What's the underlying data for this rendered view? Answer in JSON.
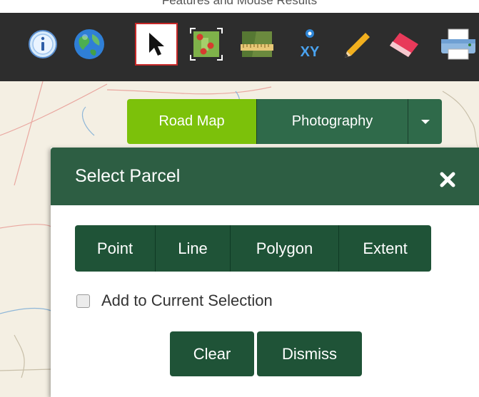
{
  "top_heading": "Features and Mouse Results",
  "toolbar": {
    "tools": [
      {
        "icon": "info-icon",
        "name": "Identify"
      },
      {
        "icon": "globe-icon",
        "name": "Map"
      },
      {
        "icon": "pointer-arrow-icon",
        "name": "Select",
        "active": true
      },
      {
        "icon": "select-parcel-icon",
        "name": "Select Parcel"
      },
      {
        "icon": "measure-ruler-icon",
        "name": "Measure"
      },
      {
        "icon": "xy-coordinate-icon",
        "name": "XY"
      },
      {
        "icon": "pencil-draw-icon",
        "name": "Draw"
      },
      {
        "icon": "eraser-icon",
        "name": "Erase"
      },
      {
        "icon": "printer-icon",
        "name": "Print"
      }
    ]
  },
  "basemap": {
    "road_map": "Road Map",
    "photography": "Photography",
    "active": "Road Map"
  },
  "dialog": {
    "title": "Select Parcel",
    "close_symbol": "×",
    "shape_buttons": [
      "Point",
      "Line",
      "Polygon",
      "Extent"
    ],
    "add_selection_label": "Add to Current Selection",
    "add_selection_checked": false,
    "clear_label": "Clear",
    "dismiss_label": "Dismiss"
  },
  "colors": {
    "toolbar_bg": "#2d2d2d",
    "dialog_header": "#2d5e43",
    "button_green": "#1f5337",
    "road_map_active": "#7cc10a",
    "active_tool_border": "#c62828"
  }
}
